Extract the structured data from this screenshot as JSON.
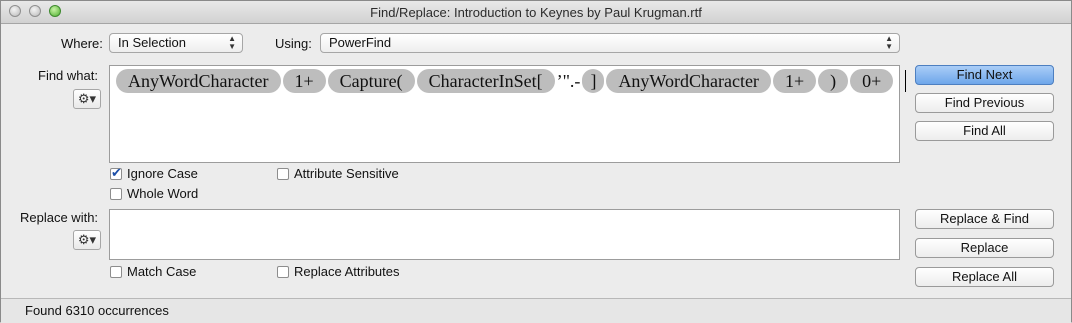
{
  "window": {
    "title": "Find/Replace: Introduction to Keynes by Paul Krugman.rtf"
  },
  "where": {
    "label": "Where:",
    "value": "In Selection"
  },
  "using": {
    "label": "Using:",
    "value": "PowerFind"
  },
  "find": {
    "label": "Find what:",
    "gear_icon": "gear-icon",
    "tokens": [
      "AnyWordCharacter",
      "1+",
      "Capture(",
      "CharacterInSet[",
      "’\".-",
      "]",
      "AnyWordCharacter",
      "1+",
      ")",
      "0+"
    ]
  },
  "options": {
    "ignore_case": {
      "label": "Ignore Case",
      "checked": true
    },
    "attribute_sensitive": {
      "label": "Attribute Sensitive",
      "checked": false
    },
    "whole_word": {
      "label": "Whole Word",
      "checked": false
    },
    "match_case": {
      "label": "Match Case",
      "checked": false
    },
    "replace_attributes": {
      "label": "Replace Attributes",
      "checked": false
    }
  },
  "replace": {
    "label": "Replace with:",
    "value": ""
  },
  "buttons": {
    "find_next": "Find Next",
    "find_previous": "Find Previous",
    "find_all": "Find All",
    "replace_and_find": "Replace & Find",
    "replace": "Replace",
    "replace_all": "Replace All"
  },
  "status": {
    "text": "Found 6310 occurrences"
  },
  "colors": {
    "token_bg": "#bdbdbd",
    "default_button": "#6ea6ea"
  }
}
